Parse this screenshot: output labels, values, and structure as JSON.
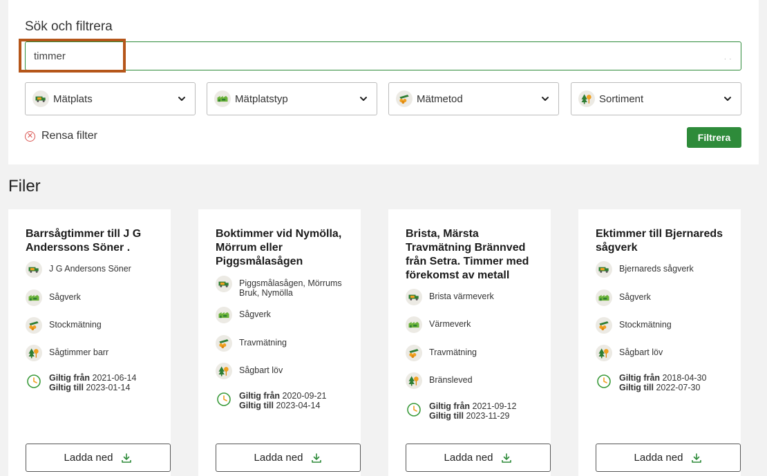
{
  "search": {
    "title": "Sök och filtrera",
    "value": "timmer",
    "dots": ". ."
  },
  "filters": [
    {
      "label": "Mätplats",
      "icon": "truck-icon"
    },
    {
      "label": "Mätplatstyp",
      "icon": "sawmill-icon"
    },
    {
      "label": "Mätmetod",
      "icon": "log-pile-icon"
    },
    {
      "label": "Sortiment",
      "icon": "tree-icon"
    }
  ],
  "clear_filter_label": "Rensa filter",
  "filter_button_label": "Filtrera",
  "files_heading": "Filer",
  "validity_from_label": "Giltig från",
  "validity_to_label": "Giltig till",
  "download_label": "Ladda ned",
  "cards": [
    {
      "title": "Barrsågtimmer till J G Anderssons Söner .",
      "place": "J G Andersons Söner",
      "place_type": "Sågverk",
      "method": "Stockmätning",
      "assortment": "Sågtimmer barr",
      "valid_from": "2021-06-14",
      "valid_to": "2023-01-14"
    },
    {
      "title": "Boktimmer vid Nymölla, Mörrum eller Piggsmålasågen",
      "place": "Piggsmålasågen, Mörrums Bruk, Nymölla",
      "place_type": "Sågverk",
      "method": "Travmätning",
      "assortment": "Sågbart löv",
      "valid_from": "2020-09-21",
      "valid_to": "2023-04-14"
    },
    {
      "title": "Brista, Märsta Travmätning Brännved från Setra. Timmer med förekomst av metall",
      "place": "Brista värmeverk",
      "place_type": "Värmeverk",
      "method": "Travmätning",
      "assortment": "Bränsleved",
      "valid_from": "2021-09-12",
      "valid_to": "2023-11-29"
    },
    {
      "title": "Ektimmer till Bjernareds sågverk",
      "place": "Bjernareds sågverk",
      "place_type": "Sågverk",
      "method": "Stockmätning",
      "assortment": "Sågbart löv",
      "valid_from": "2018-04-30",
      "valid_to": "2022-07-30"
    }
  ],
  "colors": {
    "accent_green": "#2e8b3a",
    "highlight_orange": "#b5561a",
    "icon_orange": "#f0a020",
    "clear_red": "#d9534f"
  }
}
